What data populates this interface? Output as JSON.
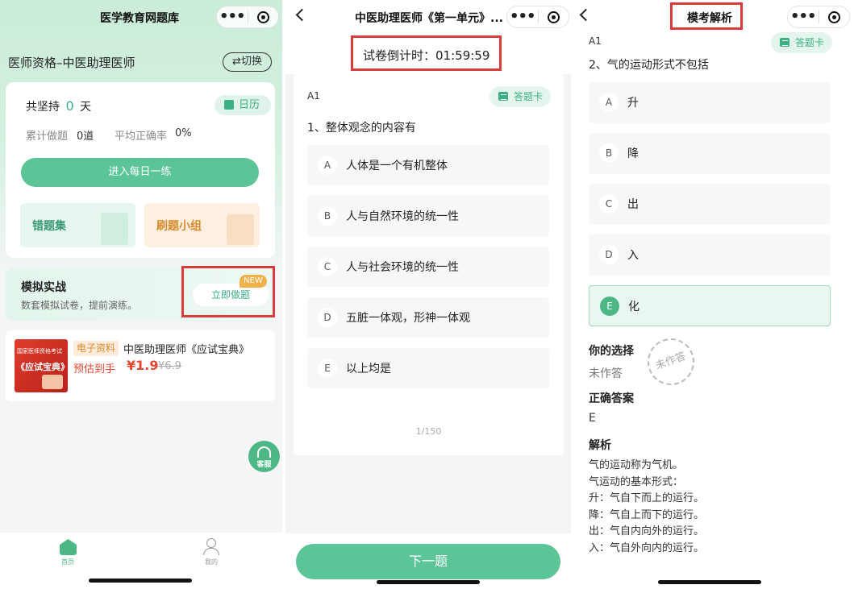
{
  "colors": {
    "accent": "#5cc598",
    "highlight": "#dc3b3b",
    "price": "#e8462f",
    "orange": "#d98a2b"
  },
  "panel1": {
    "title": "医学教育网题库",
    "qualification": "医师资格–中医助理医师",
    "switch_label": "⇄切换",
    "streak_prefix": "共坚持",
    "streak_days": "0",
    "streak_suffix": "天",
    "calendar_label": "日历",
    "total_label": "累计做题",
    "total_value": "0道",
    "accuracy_label": "平均正确率",
    "accuracy_value": "0%",
    "daily_button": "进入每日一练",
    "wrong_set": "错题集",
    "study_group": "刷题小组",
    "mock_title": "模拟实战",
    "mock_desc": "数套模拟试卷，提前演练。",
    "mock_button": "立即做题",
    "new_badge": "NEW",
    "product_cover_line1": "国家医师资格考试",
    "product_cover_line2": "《应试宝典》",
    "product_tag": "电子资料",
    "product_name": "中医助理医师《应试宝典》",
    "estimate_label": "预估到手",
    "price": "¥1.9",
    "original_price": "¥6.9",
    "service_label": "客服",
    "nav_home": "首页",
    "nav_mine": "我的"
  },
  "panel2": {
    "title": "中医助理医师《第一单元》...",
    "timer_label": "试卷倒计时：",
    "timer_value": "01:59:59",
    "section": "A1",
    "answer_card": "答题卡",
    "question": "1、整体观念的内容有",
    "options": [
      {
        "key": "A",
        "text": "人体是一个有机整体"
      },
      {
        "key": "B",
        "text": "人与自然环境的统一性"
      },
      {
        "key": "C",
        "text": "人与社会环境的统一性"
      },
      {
        "key": "D",
        "text": "五脏一体观，形神一体观"
      },
      {
        "key": "E",
        "text": "以上均是"
      }
    ],
    "page_indicator": "1/150",
    "next_button": "下一题"
  },
  "panel3": {
    "title": "模考解析",
    "section": "A1",
    "answer_card": "答题卡",
    "question": "2、气的运动形式不包括",
    "options": [
      {
        "key": "A",
        "text": "升"
      },
      {
        "key": "B",
        "text": "降"
      },
      {
        "key": "C",
        "text": "出"
      },
      {
        "key": "D",
        "text": "入"
      },
      {
        "key": "E",
        "text": "化"
      }
    ],
    "your_choice_label": "你的选择",
    "your_choice_value": "未作答",
    "stamp_text": "未作答",
    "correct_label": "正确答案",
    "correct_value": "E",
    "analysis_label": "解析",
    "analysis_lines": [
      "气的运动称为气机。",
      "气运动的基本形式：",
      "升：气自下而上的运行。",
      "降：气自上而下的运行。",
      "出：气自内向外的运行。",
      "入：气自外向内的运行。"
    ]
  }
}
